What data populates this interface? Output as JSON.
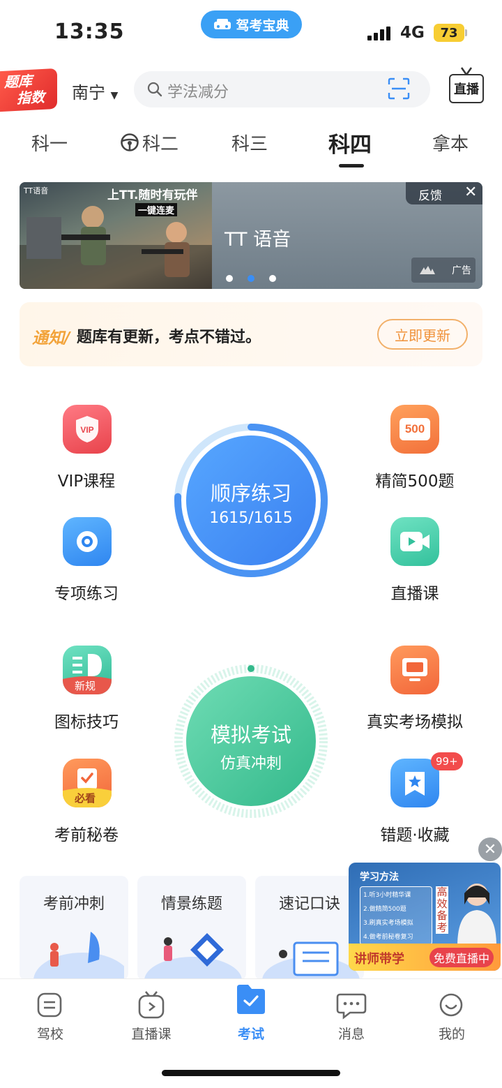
{
  "status_bar": {
    "time": "13:35",
    "app_name": "驾考宝典",
    "network": "4G",
    "battery": "73"
  },
  "header": {
    "badge_line1": "题库",
    "badge_line2": "指数",
    "city": "南宁",
    "search_placeholder": "学法减分",
    "live_label": "直播"
  },
  "subject_tabs": [
    {
      "label": "科一",
      "active": false
    },
    {
      "label": "科二",
      "active": false
    },
    {
      "label": "科三",
      "active": false
    },
    {
      "label": "科四",
      "active": true
    },
    {
      "label": "拿本",
      "active": false
    }
  ],
  "banner": {
    "logo": "TT语音",
    "headline": "上TT.随时有玩伴",
    "sub": "一键连麦",
    "title": "TT 语音",
    "feedback": "反馈",
    "ad_label": "广告",
    "slide_active": 2,
    "slide_count": 3
  },
  "notice": {
    "tag": "通知/",
    "text": "题库有更新，考点不错过。",
    "button": "立即更新"
  },
  "features": {
    "vip": {
      "label": "VIP课程",
      "icon_text": "VIP"
    },
    "jingjian": {
      "label": "精简500题",
      "icon_text": "500"
    },
    "zhuanxiang": {
      "label": "专项练习"
    },
    "zhibo": {
      "label": "直播课"
    },
    "tubiao": {
      "label": "图标技巧",
      "icon_badge": "新规"
    },
    "zhenshi": {
      "label": "真实考场模拟"
    },
    "miquan": {
      "label": "考前秘卷",
      "icon_badge": "必看"
    },
    "cuoti": {
      "label": "错题·收藏",
      "badge": "99+"
    },
    "sequence": {
      "title": "顺序练习",
      "progress": "1615/1615"
    },
    "mock": {
      "title": "模拟考试",
      "subtitle": "仿真冲刺"
    }
  },
  "cards": [
    {
      "title": "考前冲刺"
    },
    {
      "title": "情景练题"
    },
    {
      "title": "速记口诀"
    }
  ],
  "float_ad": {
    "heading": "学习方法",
    "steps": [
      "1.听3小时精华课",
      "2.做精简500题",
      "3.刷真实考场模拟",
      "4.做考前秘卷复习"
    ],
    "side_text": "高效备考",
    "left_cta": "讲师带学",
    "right_cta": "免费直播中"
  },
  "bottom_nav": [
    {
      "label": "驾校",
      "active": false
    },
    {
      "label": "直播课",
      "active": false
    },
    {
      "label": "考试",
      "active": true
    },
    {
      "label": "消息",
      "active": false
    },
    {
      "label": "我的",
      "active": false
    }
  ],
  "colors": {
    "primary": "#3a8ef6",
    "green": "#4fcfa3",
    "orange": "#f2a33a",
    "red": "#e8434b"
  }
}
